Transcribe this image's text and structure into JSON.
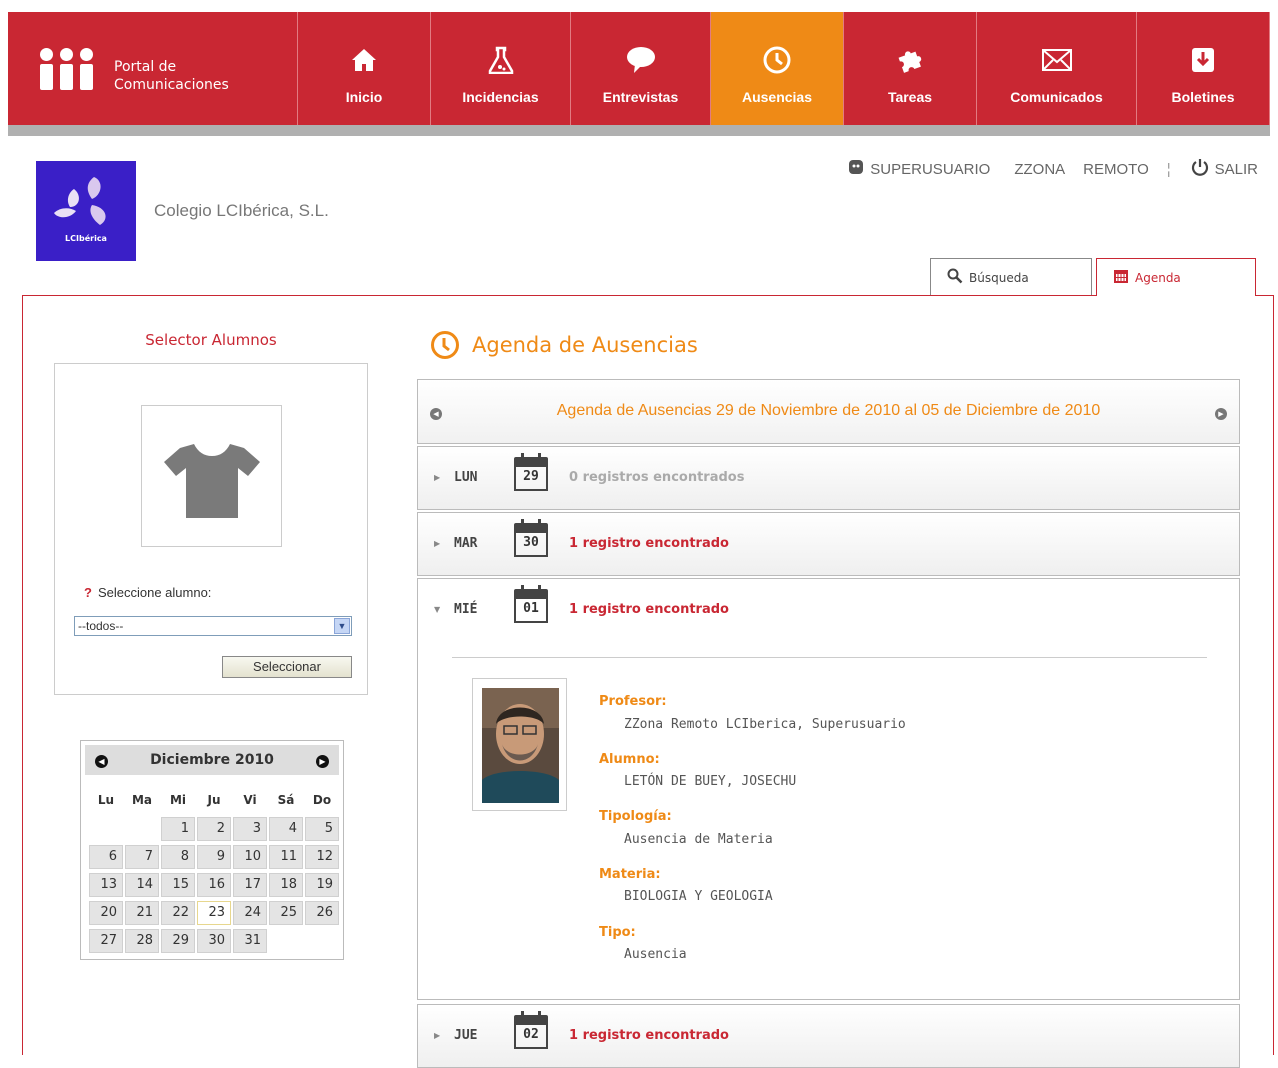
{
  "brand": {
    "line1": "Portal de",
    "line2": "Comunicaciones"
  },
  "nav": [
    {
      "label": "Inicio",
      "icon": "home-icon"
    },
    {
      "label": "Incidencias",
      "icon": "flask-icon"
    },
    {
      "label": "Entrevistas",
      "icon": "speech-bubble-icon"
    },
    {
      "label": "Ausencias",
      "icon": "clock-icon",
      "active": true
    },
    {
      "label": "Tareas",
      "icon": "puzzle-icon"
    },
    {
      "label": "Comunicados",
      "icon": "envelope-icon"
    },
    {
      "label": "Boletines",
      "icon": "download-icon"
    }
  ],
  "college": {
    "logo_text": "LCIbérica",
    "name": "Colegio LCIbérica, S.L."
  },
  "usermenu": {
    "user": "SUPERUSUARIO",
    "zone": "ZZONA",
    "remote": "REMOTO",
    "separator": "¦",
    "logout": "SALIR"
  },
  "tabs": [
    {
      "label": "Búsqueda",
      "icon": "search-icon"
    },
    {
      "label": "Agenda",
      "icon": "calendar-icon",
      "active": true
    }
  ],
  "selector": {
    "title": "Selector Alumnos",
    "prompt": "Seleccione alumno:",
    "help_mark": "?",
    "select_value": "--todos--",
    "button": "Seleccionar"
  },
  "calendar": {
    "month": "Diciembre 2010",
    "dow": [
      "Lu",
      "Ma",
      "Mi",
      "Ju",
      "Vi",
      "Sá",
      "Do"
    ],
    "first_weekday_index": 2,
    "days_in_month": 31,
    "today": 23
  },
  "agenda": {
    "title": "Agenda de Ausencias",
    "week_label": "Agenda de Ausencias 29 de Noviembre de 2010 al 05 de Diciembre de 2010",
    "days": [
      {
        "name": "LUN",
        "date": "29",
        "count": "0 registros encontrados",
        "zero": true,
        "open": false
      },
      {
        "name": "MAR",
        "date": "30",
        "count": "1 registro encontrado",
        "zero": false,
        "open": false
      },
      {
        "name": "MIÉ",
        "date": "01",
        "count": "1 registro encontrado",
        "zero": false,
        "open": true
      },
      {
        "name": "JUE",
        "date": "02",
        "count": "1 registro encontrado",
        "zero": false,
        "open": false
      }
    ],
    "record": {
      "profesor_label": "Profesor:",
      "profesor": "ZZona Remoto LCIberica, Superusuario",
      "alumno_label": "Alumno:",
      "alumno": "LETÓN DE BUEY, JOSECHU",
      "tipologia_label": "Tipología:",
      "tipologia": "Ausencia de Materia",
      "materia_label": "Materia:",
      "materia": "BIOLOGIA Y GEOLOGIA",
      "tipo_label": "Tipo:",
      "tipo": "Ausencia"
    }
  },
  "colors": {
    "brand_red": "#c92733",
    "accent_orange": "#ef8a16"
  }
}
